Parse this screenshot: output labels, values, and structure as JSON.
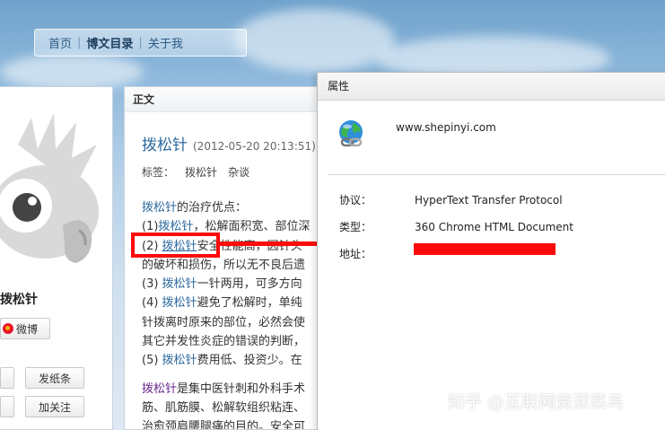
{
  "nav": {
    "items": [
      {
        "label": "首页"
      },
      {
        "label": "博文目录"
      },
      {
        "label": "关于我"
      }
    ]
  },
  "sidebar": {
    "blogger_name": "拨松针",
    "weibo_label": "微博",
    "buttons": {
      "b1": "",
      "b2": "发纸条",
      "b3": "",
      "b4": "加关注"
    }
  },
  "article": {
    "section_title": "正文",
    "post_title": "拨松针",
    "post_date": "(2012-05-20 20:13:51)",
    "tags_label": "标签：",
    "tags": [
      "拨松针",
      "杂谈"
    ],
    "lines": [
      {
        "kw": "拨松针",
        "rest": "的治疗优点："
      },
      {
        "pre": "(1)",
        "kw": "拨松针",
        "rest": "，松解面积宽、部位深"
      },
      {
        "pre": "(2) ",
        "kw": "拨松针",
        "rest": "安全性能高，因针头"
      },
      {
        "pre": "",
        "kw": "",
        "rest": "的破坏和损伤，所以无不良后遗"
      },
      {
        "pre": "(3) ",
        "kw": "拨松针",
        "rest": "一针两用，可多方向"
      },
      {
        "pre": "(4) ",
        "kw": "拨松针",
        "rest": "避免了松解时，单纯"
      },
      {
        "pre": "",
        "kw": "",
        "rest": "针拨离时原来的部位，必然会使"
      },
      {
        "pre": "",
        "kw": "",
        "rest": "其它并发性炎症的错误的判断，"
      },
      {
        "pre": "(5) ",
        "kw": "拨松针",
        "rest": "费用低、投资少。在"
      }
    ],
    "para2": [
      {
        "kw": "拨松针",
        "rest": "是集中医针刺和外科手术"
      },
      {
        "kw": "",
        "rest": "筋、肌筋膜、松解软组织粘连、"
      },
      {
        "kw": "",
        "rest": "治愈颈肩腰腿痛的目的。安全可"
      }
    ]
  },
  "dialog": {
    "title": "属性",
    "url": "www.shepinyi.com",
    "protocol_label": "协议：",
    "protocol_value": "HyperText Transfer Protocol",
    "type_label": "类型：",
    "type_value": "360 Chrome HTML Document",
    "address_label": "地址："
  },
  "watermark": "知乎 @互联网资深菜鸟",
  "colors": {
    "highlight": "#ff0a0a",
    "link": "#2e6a9e"
  }
}
